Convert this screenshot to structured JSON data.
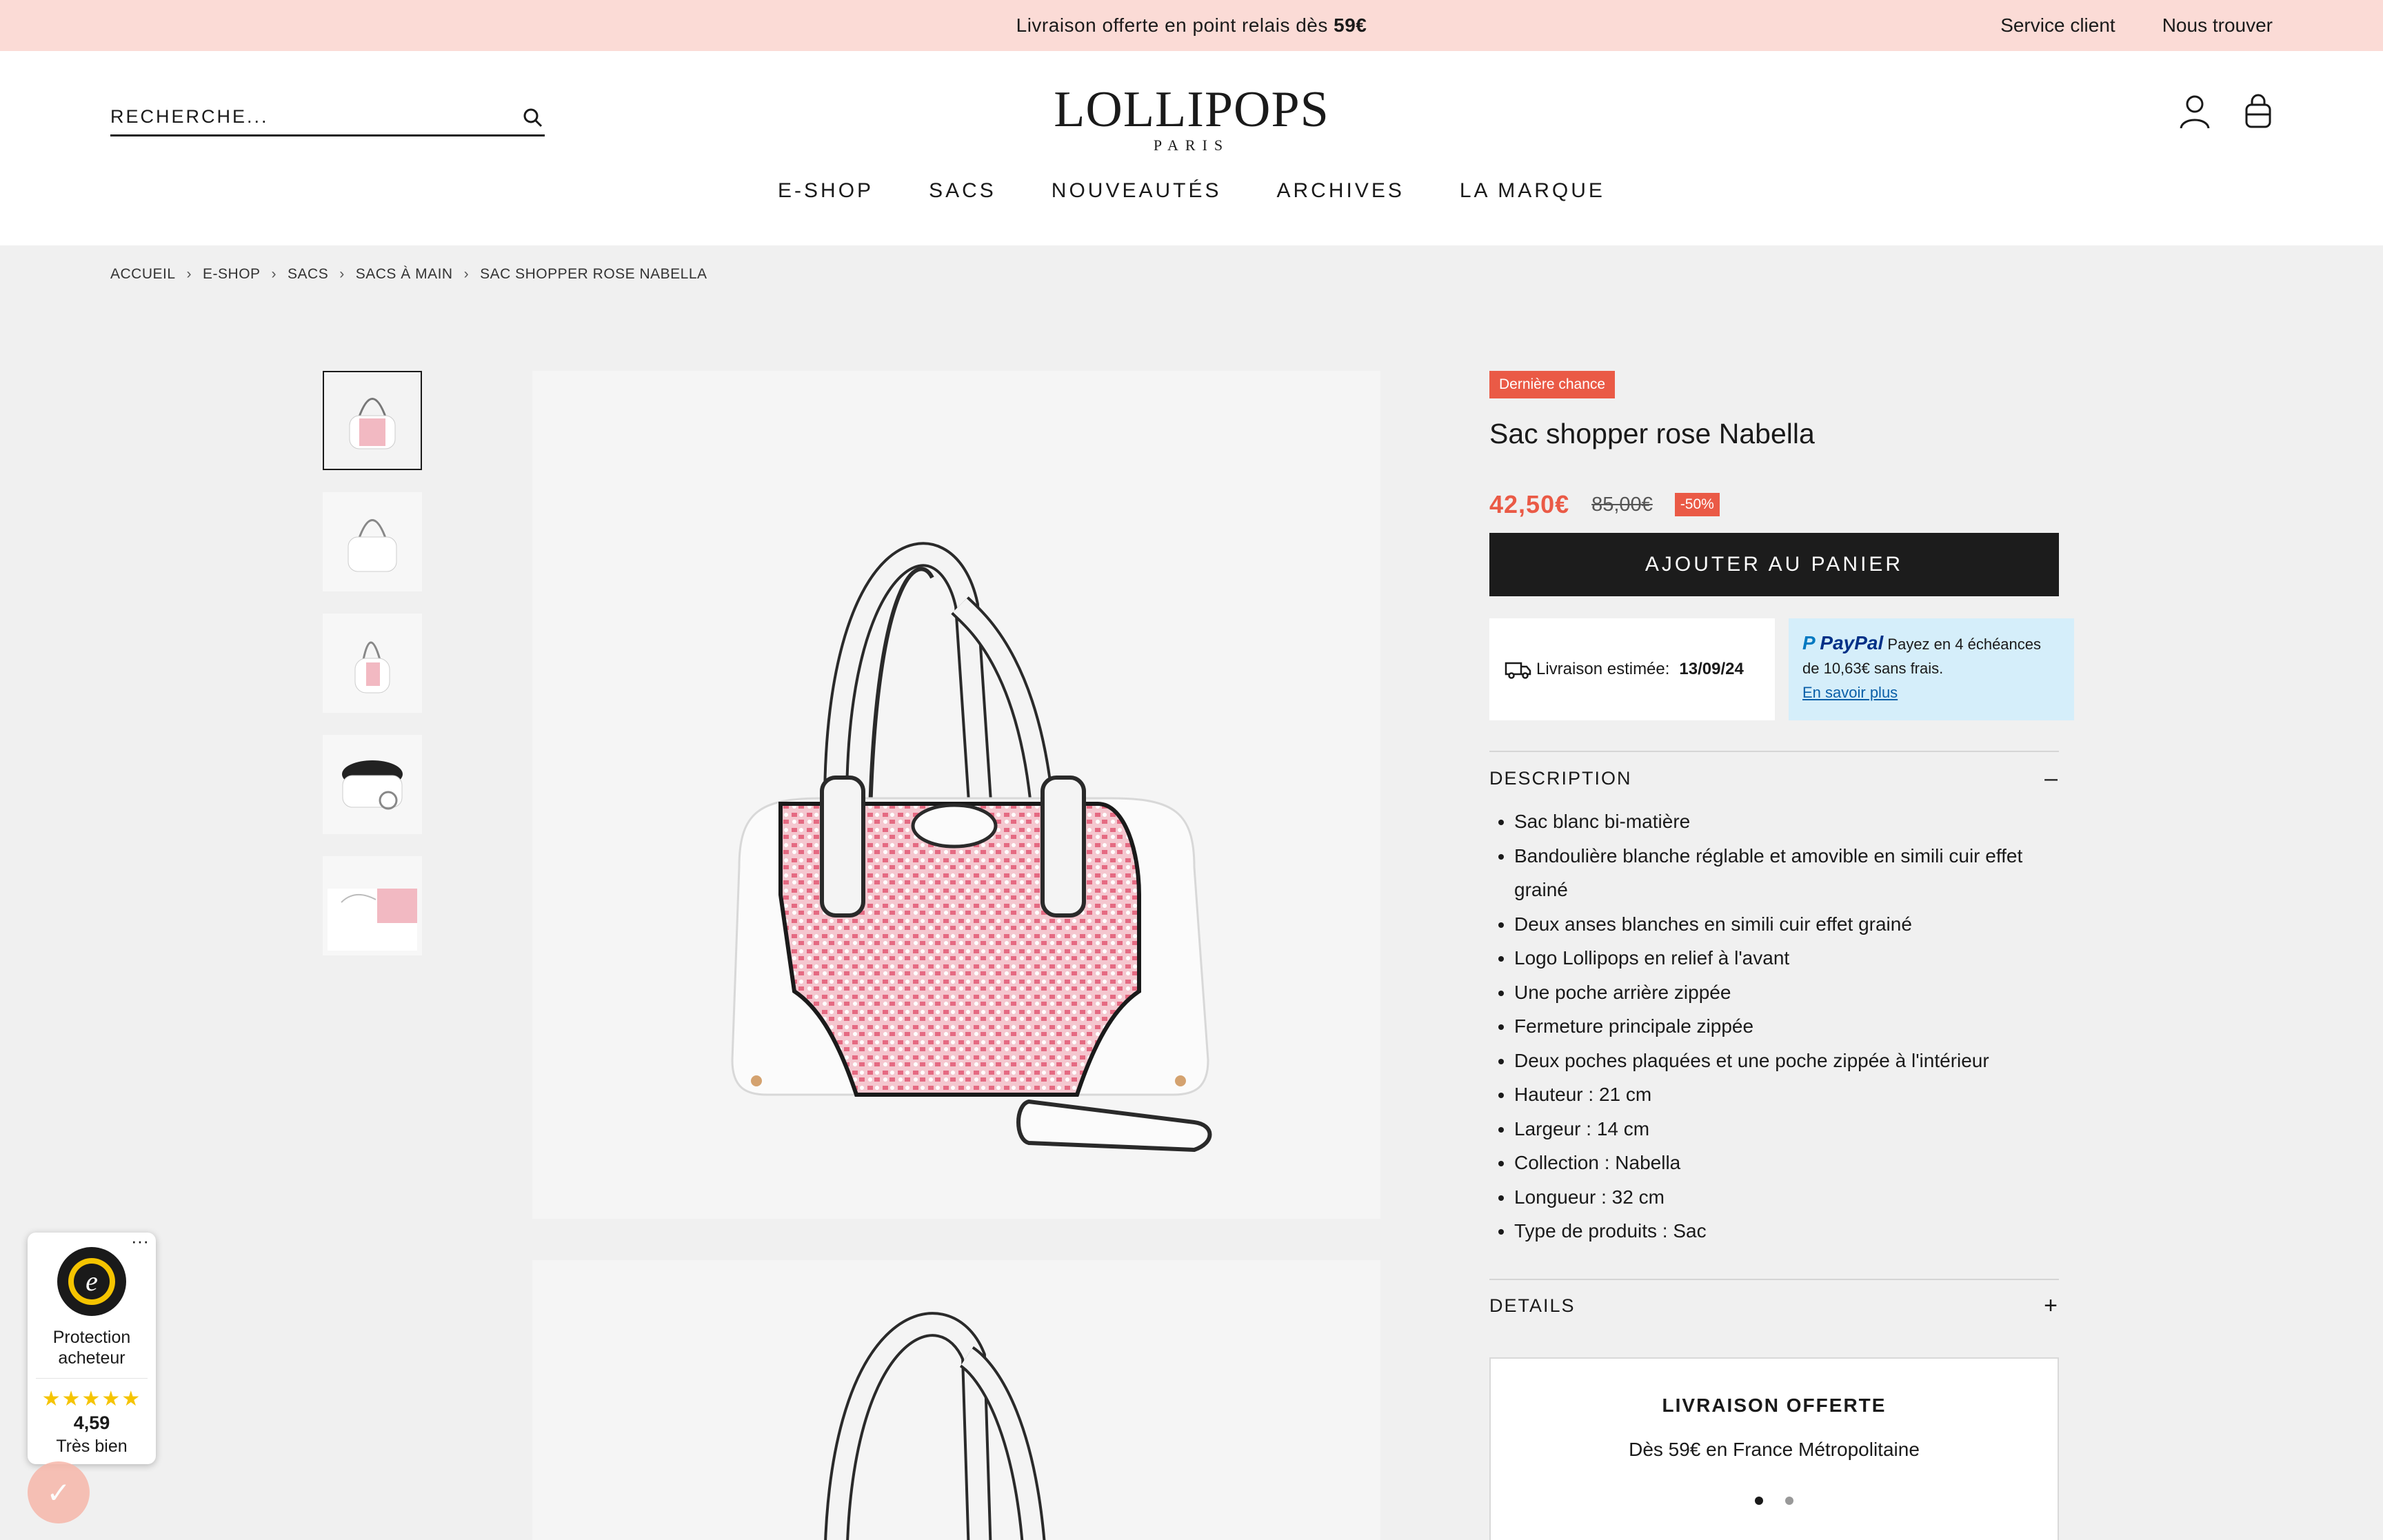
{
  "promo": {
    "message_prefix": "Livraison offerte en point relais dès",
    "message_amount": "59€",
    "links": [
      "Service client",
      "Nous trouver"
    ]
  },
  "header": {
    "search_placeholder": "RECHERCHE...",
    "logo_main": "LOLLIPOPS",
    "logo_sub": "PARIS",
    "nav": [
      "E-SHOP",
      "SACS",
      "NOUVEAUTÉS",
      "ARCHIVES",
      "LA MARQUE"
    ]
  },
  "breadcrumb": [
    "ACCUEIL",
    "E-SHOP",
    "SACS",
    "SACS À MAIN",
    "SAC SHOPPER ROSE NABELLA"
  ],
  "product": {
    "badge": "Dernière chance",
    "title": "Sac shopper rose Nabella",
    "price_new": "42,50€",
    "price_old": "85,00€",
    "discount": "-50%",
    "add_to_cart": "AJOUTER AU PANIER",
    "delivery_label": "Livraison estimée:",
    "delivery_date": "13/09/24",
    "paypal_brand": "PayPal",
    "paypal_text": "Payez en 4 échéances de 10,63€ sans frais.",
    "paypal_link": "En savoir plus",
    "description_title": "DESCRIPTION",
    "description_toggle": "–",
    "description_items": [
      "Sac blanc bi-matière",
      "Bandoulière blanche réglable et amovible en simili cuir effet grainé",
      "Deux anses blanches en simili cuir effet grainé",
      "Logo Lollipops en relief à l'avant",
      "Une poche arrière zippée",
      "Fermeture principale zippée",
      "Deux poches plaquées et une poche zippée à l'intérieur",
      "Hauteur : 21 cm",
      "Largeur : 14 cm",
      "Collection : Nabella",
      "Longueur : 32 cm",
      "Type de produits : Sac"
    ],
    "details_title": "DETAILS",
    "details_toggle": "+",
    "livraison_title": "LIVRAISON OFFERTE",
    "livraison_text": "Dès 59€ en France Métropolitaine"
  },
  "trust": {
    "more": "···",
    "protection": "Protection acheteur",
    "stars": "★★★★★",
    "score": "4,59",
    "label": "Très bien"
  },
  "colors": {
    "promo_bg": "#fbdbd6",
    "accent": "#ea5a46",
    "button_bg": "#1c1c1c",
    "paypal_bg": "#d5eefa"
  }
}
